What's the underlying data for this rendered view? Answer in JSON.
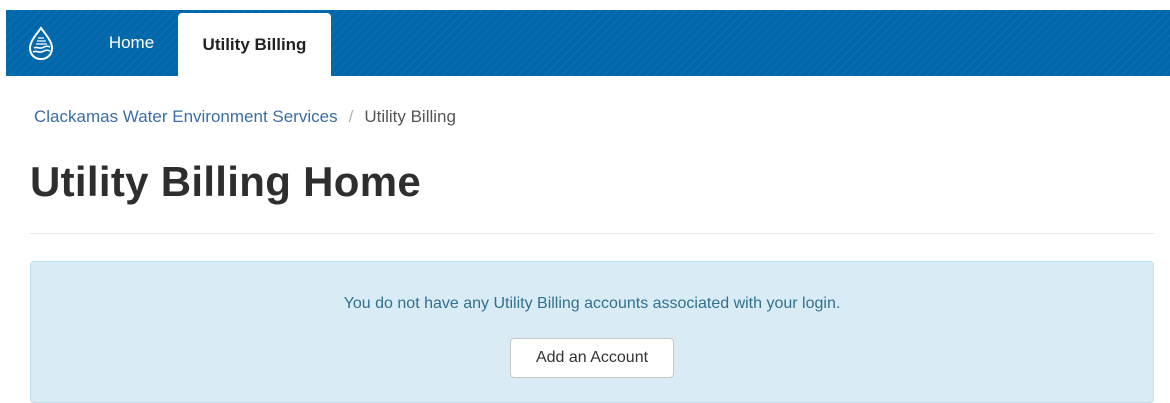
{
  "nav": {
    "logo_icon": "water-drop-logo-icon",
    "tabs": [
      {
        "label": "Home",
        "active": false
      },
      {
        "label": "Utility Billing",
        "active": true
      }
    ]
  },
  "breadcrumb": {
    "parent": "Clackamas Water Environment Services",
    "separator": "/",
    "current": "Utility Billing"
  },
  "page": {
    "title": "Utility Billing Home"
  },
  "alert": {
    "message": "You do not have any Utility Billing accounts associated with your login.",
    "button_label": "Add an Account"
  },
  "colors": {
    "nav_bg": "#0067ab",
    "alert_bg": "#d9ecf5",
    "alert_text": "#31708f",
    "link": "#3a6ea5"
  }
}
